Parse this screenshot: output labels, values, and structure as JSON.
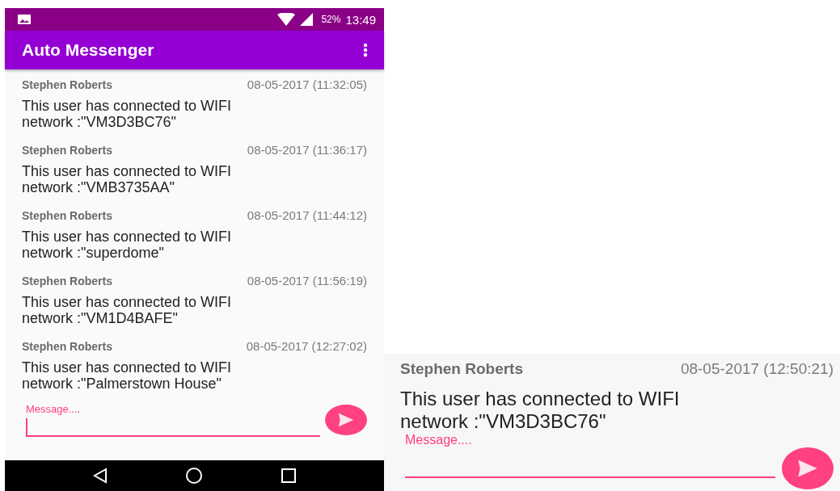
{
  "status_bar": {
    "battery": "52%",
    "time": "13:49"
  },
  "app_bar": {
    "title": "Auto Messenger"
  },
  "messages": [
    {
      "sender": "Stephen Roberts",
      "time": "08-05-2017 (11:32:05)",
      "text": "This user has connected to WIFI network :\"VM3D3BC76\""
    },
    {
      "sender": "Stephen Roberts",
      "time": "08-05-2017 (11:36:17)",
      "text": "This user has connected to WIFI network :\"VMB3735AA\""
    },
    {
      "sender": "Stephen Roberts",
      "time": "08-05-2017 (11:44:12)",
      "text": "This user has connected to WIFI network :\"superdome\""
    },
    {
      "sender": "Stephen Roberts",
      "time": "08-05-2017 (11:56:19)",
      "text": "This user has connected to WIFI network :\"VM1D4BAFE\""
    },
    {
      "sender": "Stephen Roberts",
      "time": "08-05-2017 (12:27:02)",
      "text": "This user has connected to WIFI network :\"Palmerstown House\""
    }
  ],
  "message_input": {
    "placeholder": "Message...."
  },
  "zoomed_view": {
    "message": {
      "sender": "Stephen Roberts",
      "time": "08-05-2017 (12:50:21)",
      "text": "This user has connected to WIFI network :\"VM3D3BC76\""
    },
    "message_input": {
      "placeholder": "Message...."
    }
  }
}
